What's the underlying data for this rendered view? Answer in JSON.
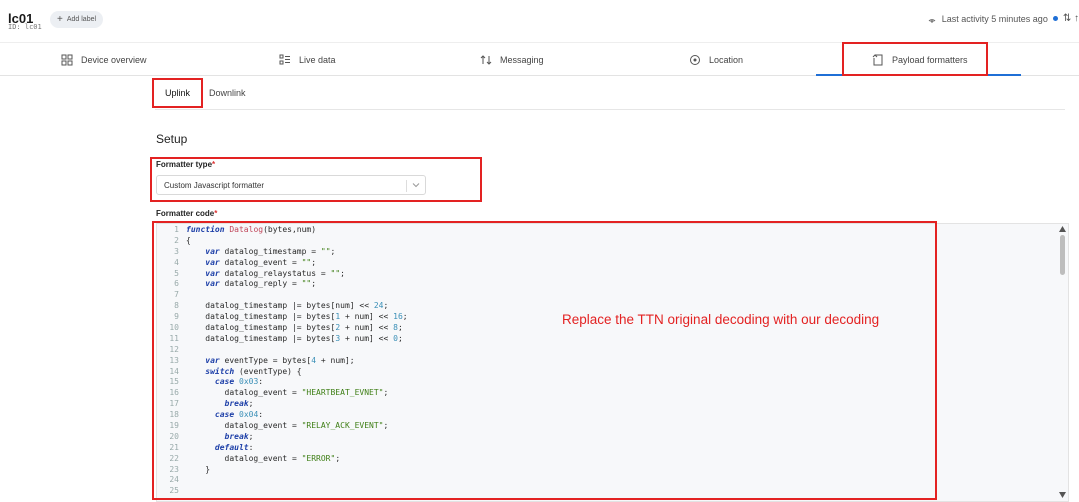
{
  "header": {
    "device_title": "lc01",
    "device_id": "ID: lc01",
    "add_label": "Add label",
    "activity": "Last activity 5 minutes ago"
  },
  "tabs": [
    {
      "label": "Device overview",
      "icon": "grid-icon"
    },
    {
      "label": "Live data",
      "icon": "list-icon"
    },
    {
      "label": "Messaging",
      "icon": "arrows-updown-icon"
    },
    {
      "label": "Location",
      "icon": "location-pin-icon"
    },
    {
      "label": "Payload formatters",
      "icon": "code-bracket-icon",
      "active": true
    }
  ],
  "subtabs": [
    {
      "label": "Uplink",
      "active": true
    },
    {
      "label": "Downlink",
      "active": false
    }
  ],
  "setup": {
    "heading": "Setup",
    "formatter_type_label": "Formatter type",
    "formatter_type_value": "Custom Javascript formatter",
    "formatter_code_label": "Formatter code",
    "required_mark": "*"
  },
  "code_lines": [
    "function Datalog(bytes,num)",
    "{",
    "    var datalog_timestamp = \"\";",
    "    var datalog_event = \"\";",
    "    var datalog_relaystatus = \"\";",
    "    var datalog_reply = \"\";",
    "",
    "    datalog_timestamp |= bytes[num] << 24;",
    "    datalog_timestamp |= bytes[1 + num] << 16;",
    "    datalog_timestamp |= bytes[2 + num] << 8;",
    "    datalog_timestamp |= bytes[3 + num] << 0;",
    "",
    "    var eventType = bytes[4 + num];",
    "    switch (eventType) {",
    "      case 0x03:",
    "        datalog_event = \"HEARTBEAT_EVNET\";",
    "        break;",
    "      case 0x04:",
    "        datalog_event = \"RELAY_ACK_EVENT\";",
    "        break;",
    "      default:",
    "        datalog_event = \"ERROR\";",
    "    }",
    "",
    ""
  ],
  "annotation": "Replace the TTN original decoding with our decoding",
  "colors": {
    "accent": "#1f6fd6",
    "annotation_red": "#e32222"
  }
}
